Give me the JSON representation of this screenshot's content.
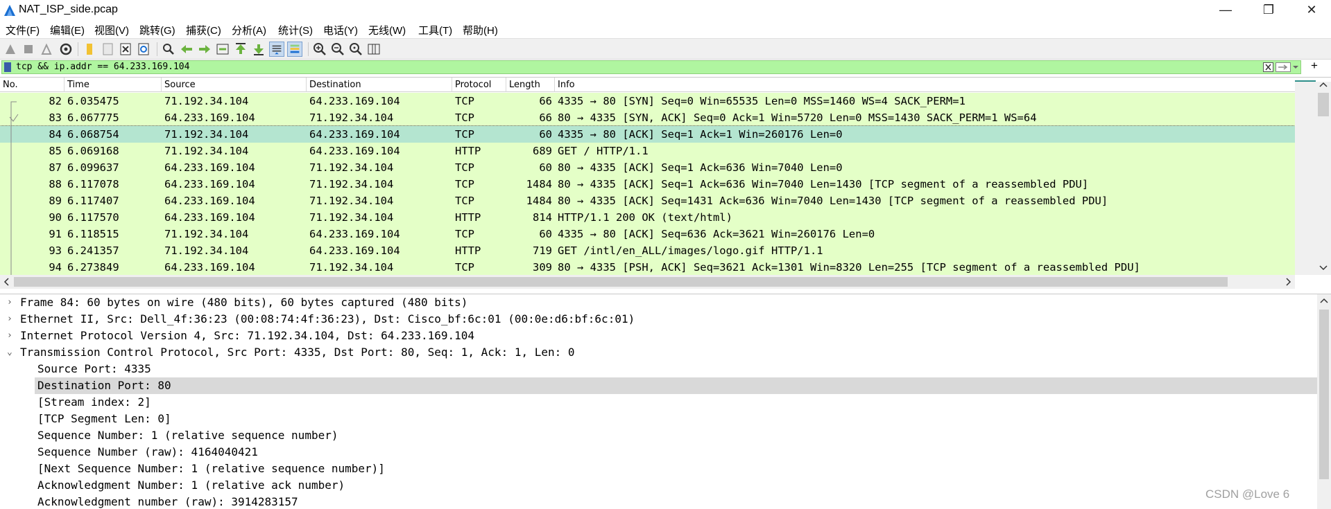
{
  "window": {
    "title": "NAT_ISP_side.pcap",
    "minimize": "—",
    "restore": "❐",
    "close": "✕"
  },
  "menu": [
    "文件(F)",
    "编辑(E)",
    "视图(V)",
    "跳转(G)",
    "捕获(C)",
    "分析(A)",
    "统计(S)",
    "电话(Y)",
    "无线(W)",
    "工具(T)",
    "帮助(H)"
  ],
  "filter": {
    "value": "tcp && ip.addr == 64.233.169.104",
    "add_label": "+"
  },
  "columns": [
    "No.",
    "Time",
    "Source",
    "Destination",
    "Protocol",
    "Length",
    "Info"
  ],
  "packets": [
    {
      "no": "82",
      "time": "6.035475",
      "src": "71.192.34.104",
      "dst": "64.233.169.104",
      "proto": "TCP",
      "len": "66",
      "info": "4335 → 80 [SYN] Seq=0 Win=65535 Len=0 MSS=1460 WS=4 SACK_PERM=1"
    },
    {
      "no": "83",
      "time": "6.067775",
      "src": "64.233.169.104",
      "dst": "71.192.34.104",
      "proto": "TCP",
      "len": "66",
      "info": "80 → 4335 [SYN, ACK] Seq=0 Ack=1 Win=5720 Len=0 MSS=1430 SACK_PERM=1 WS=64"
    },
    {
      "no": "84",
      "time": "6.068754",
      "src": "71.192.34.104",
      "dst": "64.233.169.104",
      "proto": "TCP",
      "len": "60",
      "info": "4335 → 80 [ACK] Seq=1 Ack=1 Win=260176 Len=0",
      "selected": true
    },
    {
      "no": "85",
      "time": "6.069168",
      "src": "71.192.34.104",
      "dst": "64.233.169.104",
      "proto": "HTTP",
      "len": "689",
      "info": "GET / HTTP/1.1"
    },
    {
      "no": "87",
      "time": "6.099637",
      "src": "64.233.169.104",
      "dst": "71.192.34.104",
      "proto": "TCP",
      "len": "60",
      "info": "80 → 4335 [ACK] Seq=1 Ack=636 Win=7040 Len=0"
    },
    {
      "no": "88",
      "time": "6.117078",
      "src": "64.233.169.104",
      "dst": "71.192.34.104",
      "proto": "TCP",
      "len": "1484",
      "info": "80 → 4335 [ACK] Seq=1 Ack=636 Win=7040 Len=1430 [TCP segment of a reassembled PDU]"
    },
    {
      "no": "89",
      "time": "6.117407",
      "src": "64.233.169.104",
      "dst": "71.192.34.104",
      "proto": "TCP",
      "len": "1484",
      "info": "80 → 4335 [ACK] Seq=1431 Ack=636 Win=7040 Len=1430 [TCP segment of a reassembled PDU]"
    },
    {
      "no": "90",
      "time": "6.117570",
      "src": "64.233.169.104",
      "dst": "71.192.34.104",
      "proto": "HTTP",
      "len": "814",
      "info": "HTTP/1.1 200 OK  (text/html)"
    },
    {
      "no": "91",
      "time": "6.118515",
      "src": "71.192.34.104",
      "dst": "64.233.169.104",
      "proto": "TCP",
      "len": "60",
      "info": "4335 → 80 [ACK] Seq=636 Ack=3621 Win=260176 Len=0"
    },
    {
      "no": "93",
      "time": "6.241357",
      "src": "71.192.34.104",
      "dst": "64.233.169.104",
      "proto": "HTTP",
      "len": "719",
      "info": "GET /intl/en_ALL/images/logo.gif HTTP/1.1"
    },
    {
      "no": "94",
      "time": "6.273849",
      "src": "64.233.169.104",
      "dst": "71.192.34.104",
      "proto": "TCP",
      "len": "309",
      "info": "80 → 4335 [PSH, ACK] Seq=3621 Ack=1301 Win=8320 Len=255 [TCP segment of a reassembled PDU]"
    }
  ],
  "details": {
    "frame": "Frame 84: 60 bytes on wire (480 bits), 60 bytes captured (480 bits)",
    "ethernet": "Ethernet II, Src: Dell_4f:36:23 (00:08:74:4f:36:23), Dst: Cisco_bf:6c:01 (00:0e:d6:bf:6c:01)",
    "ip": "Internet Protocol Version 4, Src: 71.192.34.104, Dst: 64.233.169.104",
    "tcp": "Transmission Control Protocol, Src Port: 4335, Dst Port: 80, Seq: 1, Ack: 1, Len: 0",
    "tcp_fields": [
      "Source Port: 4335",
      "Destination Port: 80",
      "[Stream index: 2]",
      "[TCP Segment Len: 0]",
      "Sequence Number: 1    (relative sequence number)",
      "Sequence Number (raw): 4164040421",
      "[Next Sequence Number: 1    (relative sequence number)]",
      "Acknowledgment Number: 1    (relative ack number)",
      "Acknowledgment number (raw): 3914283157"
    ],
    "arrows": {
      "collapsed": "›",
      "expanded": "⌄"
    }
  },
  "watermark": "CSDN @Love 6",
  "colors": {
    "row_bg": "#e4ffc7",
    "selected_row_bg": "#b4e5d0",
    "filter_bg": "#b0f5a0",
    "highlight_field_bg": "#d9d9d9"
  }
}
